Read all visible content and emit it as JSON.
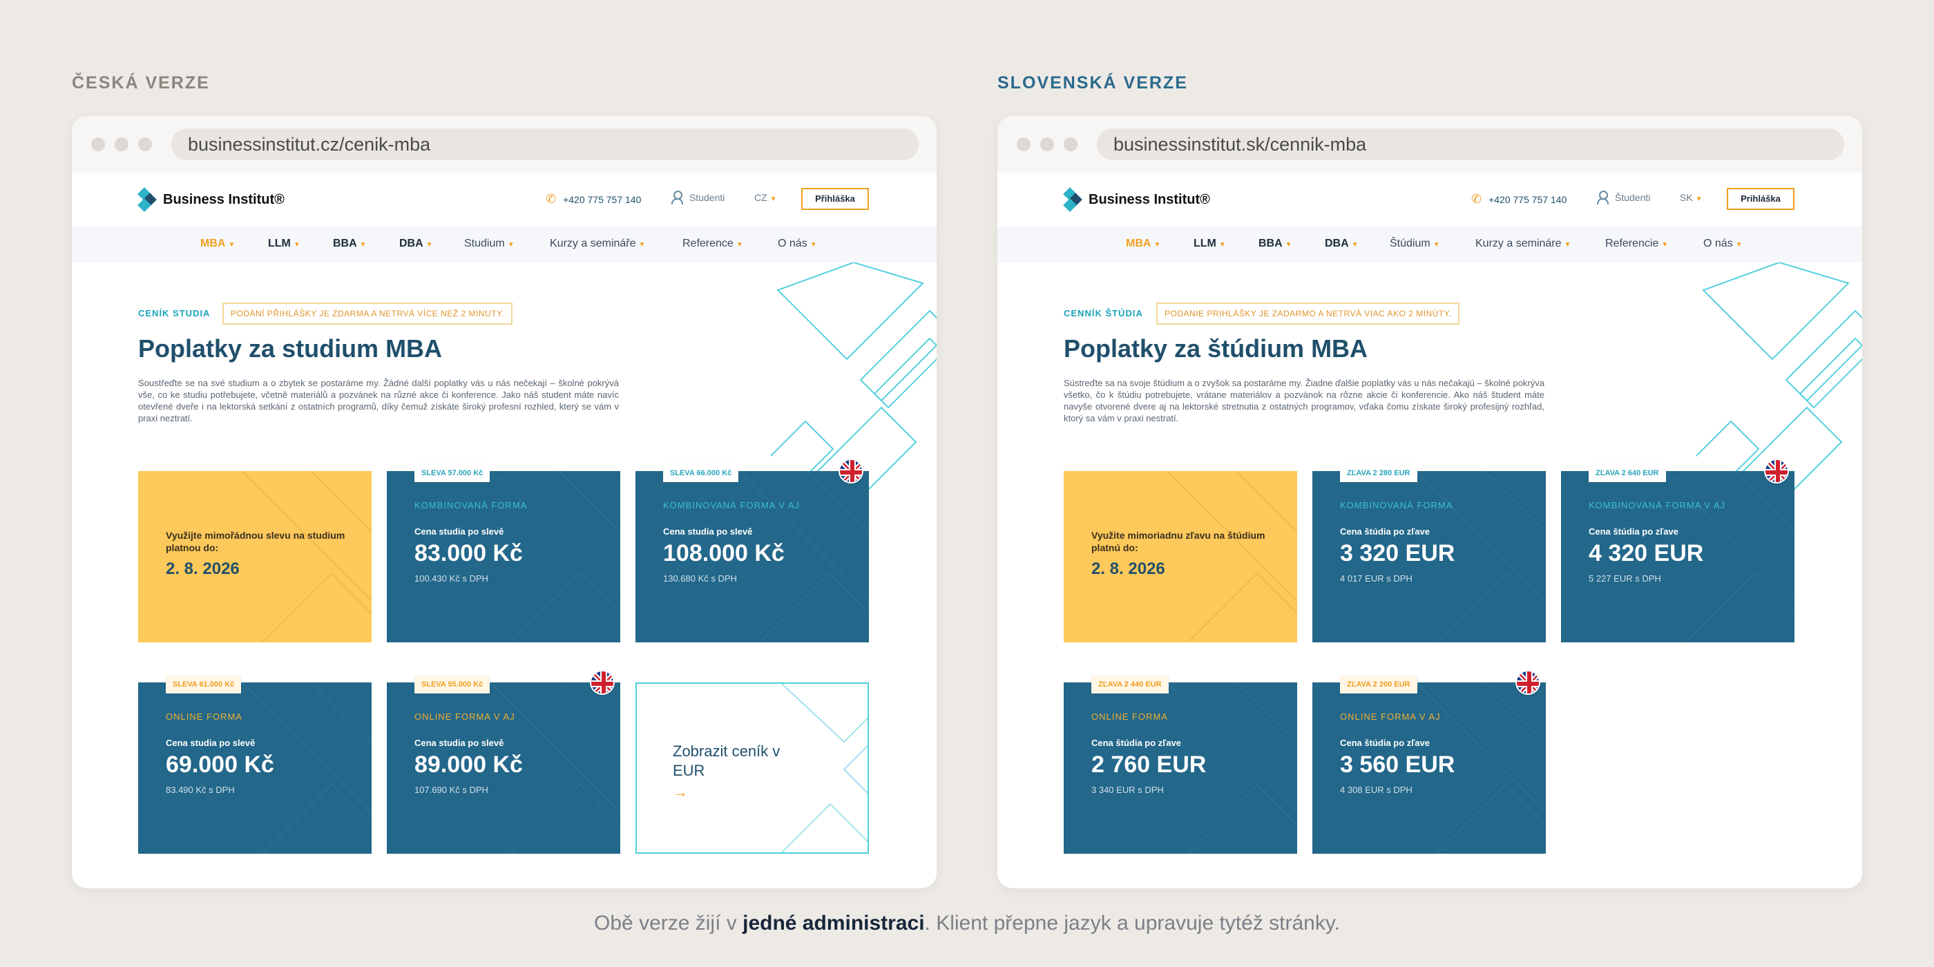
{
  "labels": {
    "cz": "ČESKÁ VERZE",
    "sk": "SLOVENSKÁ VERZE"
  },
  "caption": {
    "pre": "Obě verze žijí v ",
    "bold": "jedné administraci",
    "post": ". Klient přepne jazyk a upravuje tytéž stránky."
  },
  "colors": {
    "navy": "#1f4f6b",
    "card_blue": "#23678a",
    "promo_yellow": "#fdc95a",
    "accent_orange": "#f0a020",
    "teal": "#2db3c7"
  },
  "cz": {
    "url": "businessinstitut.cz/cenik-mba",
    "logo": "Business Institut®",
    "phone": "+420 775 757 140",
    "students": "Studenti",
    "lang": "CZ",
    "login": "Přihláška",
    "nav": [
      "MBA",
      "LLM",
      "BBA",
      "DBA",
      "Studium",
      "Kurzy a semináře",
      "Reference",
      "O nás"
    ],
    "tag": "CENÍK STUDIA",
    "note": "PODÁNÍ PŘIHLÁŠKY JE ZDARMA A NETRVÁ VÍCE NEŽ 2 MINUTY.",
    "title": "Poplatky za studium MBA",
    "intro": "Soustřeďte se na své studium a o zbytek se postaráme my. Žádné další poplatky vás u nás nečekají – školné pokrývá vše, co ke studiu potřebujete, včetně materiálů a pozvánek na různé akce či konference. Jako náš student máte navíc otevřené dveře i na lektorská setkání z ostatních programů, díky čemuž získáte široký profesní rozhled, který se vám v praxi neztratí.",
    "promo": {
      "text": "Využijte mimořádnou slevu na studium platnou do:",
      "date": "2. 8. 2026"
    },
    "cards": [
      {
        "badge": "SLEVA 57.000 Kč",
        "form": "KOMBINOVANÁ FORMA",
        "price_label": "Cena studia po slevě",
        "price": "83.000 Kč",
        "vat": "100.430 Kč s DPH",
        "flag": false
      },
      {
        "badge": "SLEVA 66.000 Kč",
        "form": "KOMBINOVANÁ FORMA V AJ",
        "price_label": "Cena studia po slevě",
        "price": "108.000 Kč",
        "vat": "130.680 Kč s DPH",
        "flag": true
      },
      {
        "badge": "SLEVA 61.000 Kč",
        "form": "ONLINE FORMA",
        "price_label": "Cena studia po slevě",
        "price": "69.000 Kč",
        "vat": "83.490 Kč s DPH",
        "flag": false
      },
      {
        "badge": "SLEVA 55.000 Kč",
        "form": "ONLINE FORMA V AJ",
        "price_label": "Cena studia po slevě",
        "price": "89.000 Kč",
        "vat": "107.690 Kč s DPH",
        "flag": true
      }
    ],
    "eur_link": {
      "text": "Zobrazit ceník v EUR",
      "arrow": "→"
    }
  },
  "sk": {
    "url": "businessinstitut.sk/cennik-mba",
    "logo": "Business Institut®",
    "phone": "+420 775 757 140",
    "students": "Študenti",
    "lang": "SK",
    "login": "Prihláška",
    "nav": [
      "MBA",
      "LLM",
      "BBA",
      "DBA",
      "Štúdium",
      "Kurzy a semináre",
      "Referencie",
      "O nás"
    ],
    "tag": "CENNÍK ŠTÚDIA",
    "note": "PODANIE PRIHLÁŠKY JE ZADARMO A NETRVÁ VIAC AKO 2 MINÚTY.",
    "title": "Poplatky za štúdium MBA",
    "intro": "Sústreďte sa na svoje štúdium a o zvyšok sa postaráme my. Žiadne ďalšie poplatky vás u nás nečakajú – školné pokrýva všetko, čo k štúdiu potrebujete, vrátane materiálov a pozvánok na rôzne akcie či konferencie. Ako náš študent máte navyše otvorené dvere aj na lektorské stretnutia z ostatných programov, vďaka čomu získate široký profesijný rozhľad, ktorý sa vám v praxi nestratí.",
    "promo": {
      "text": "Využite mimoriadnu zľavu na štúdium platnú do:",
      "date": "2. 8. 2026"
    },
    "cards": [
      {
        "badge": "ZĽAVA 2 280 EUR",
        "form": "KOMBINOVANÁ FORMA",
        "price_label": "Cena štúdia po zľave",
        "price": "3 320 EUR",
        "vat": "4 017 EUR s DPH",
        "flag": false
      },
      {
        "badge": "ZĽAVA 2 640 EUR",
        "form": "KOMBINOVANÁ FORMA V AJ",
        "price_label": "Cena štúdia po zľave",
        "price": "4 320 EUR",
        "vat": "5 227 EUR s DPH",
        "flag": true
      },
      {
        "badge": "ZĽAVA 2 440 EUR",
        "form": "ONLINE FORMA",
        "price_label": "Cena štúdia po zľave",
        "price": "2 760 EUR",
        "vat": "3 340 EUR s DPH",
        "flag": false
      },
      {
        "badge": "ZĽAVA 2 200 EUR",
        "form": "ONLINE FORMA V AJ",
        "price_label": "Cena štúdia po zľave",
        "price": "3 560 EUR",
        "vat": "4 308 EUR s DPH",
        "flag": true
      }
    ]
  }
}
